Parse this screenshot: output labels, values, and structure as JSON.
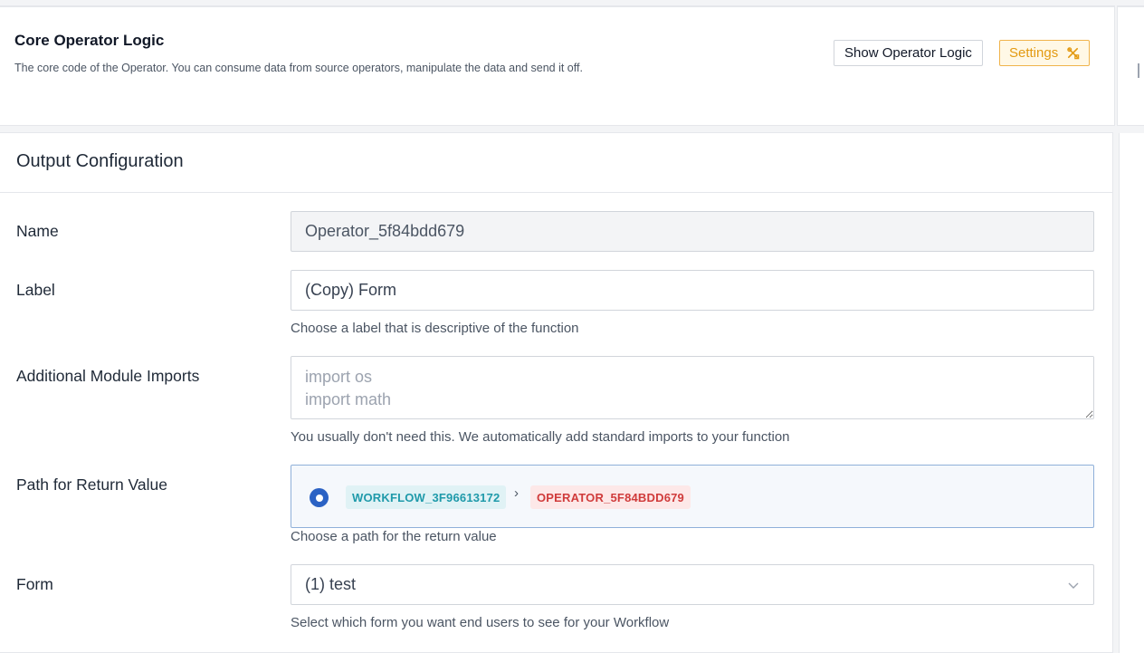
{
  "core": {
    "title": "Core Operator Logic",
    "description": "The core code of the Operator. You can consume data from source operators, manipulate the data and send it off.",
    "show_button": "Show Operator Logic",
    "settings_button": "Settings"
  },
  "output": {
    "title": "Output Configuration",
    "name": {
      "label": "Name",
      "value": "Operator_5f84bdd679"
    },
    "label_field": {
      "label": "Label",
      "value": "(Copy) Form",
      "help": "Choose a label that is descriptive of the function"
    },
    "imports": {
      "label": "Additional Module Imports",
      "placeholder": "import os\nimport math",
      "help": "You usually don't need this. We automatically add standard imports to your function"
    },
    "path": {
      "label": "Path for Return Value",
      "workflow_chip": "WORKFLOW_3F96613172",
      "separator": "›",
      "operator_chip": "OPERATOR_5F84BDD679",
      "help": "Choose a path for the return value"
    },
    "form": {
      "label": "Form",
      "value": "(1) test",
      "help": "Select which form you want end users to see for your Workflow"
    }
  },
  "colors": {
    "accent_settings": "#e39a12",
    "radio": "#2b62c4",
    "workflow_chip": "#1f9aaa",
    "operator_chip": "#d03b3b"
  }
}
